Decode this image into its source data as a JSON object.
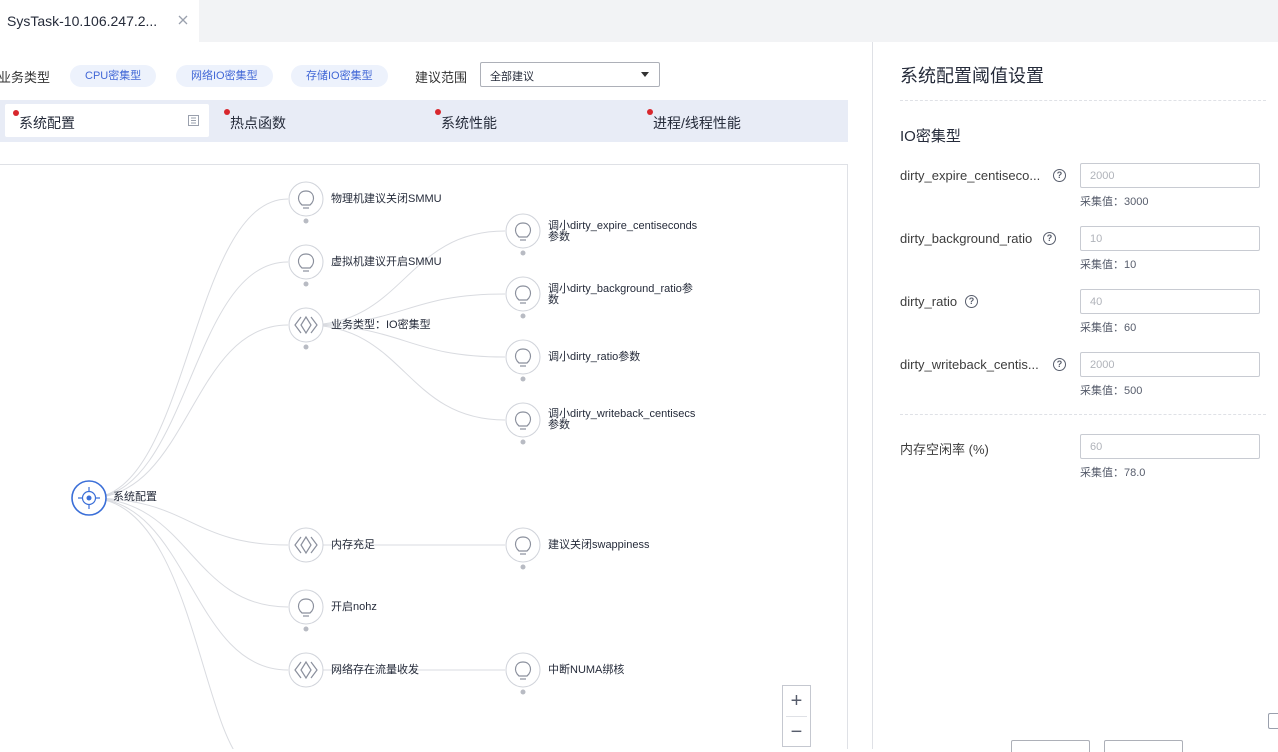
{
  "tab": {
    "title": "SysTask-10.106.247.2...",
    "close_icon": "close-icon"
  },
  "filters": {
    "business_type_label": "业务类型",
    "chips": [
      "CPU密集型",
      "网络IO密集型",
      "存储IO密集型"
    ],
    "scope_label": "建议范围",
    "scope_value": "全部建议"
  },
  "subtabs": [
    {
      "label": "系统配置",
      "active": true
    },
    {
      "label": "热点函数",
      "active": false
    },
    {
      "label": "系统性能",
      "active": false
    },
    {
      "label": "进程/线程性能",
      "active": false
    }
  ],
  "tree": {
    "root": {
      "label": "系统配置",
      "icon": "target-icon"
    },
    "branches": [
      {
        "label": "物理机建议关闭SMMU",
        "icon": "lightbulb-icon"
      },
      {
        "label": "虚拟机建议开启SMMU",
        "icon": "lightbulb-icon"
      },
      {
        "label": "业务类型：IO密集型",
        "icon": "diamond-icon"
      },
      {
        "label": "内存充足",
        "icon": "diamond-icon"
      },
      {
        "label": "开启nohz",
        "icon": "lightbulb-icon"
      },
      {
        "label": "网络存在流量收发",
        "icon": "diamond-icon"
      }
    ],
    "leaves": [
      {
        "line1": "调小dirty_expire_centiseconds",
        "line2": "参数",
        "icon": "lightbulb-icon"
      },
      {
        "line1": "调小dirty_background_ratio参",
        "line2": "数",
        "icon": "lightbulb-icon"
      },
      {
        "line1": "调小dirty_ratio参数",
        "line2": "",
        "icon": "lightbulb-icon"
      },
      {
        "line1": "调小dirty_writeback_centisecs",
        "line2": "参数",
        "icon": "lightbulb-icon"
      },
      {
        "line1": "建议关闭swappiness",
        "line2": "",
        "icon": "lightbulb-icon"
      },
      {
        "line1": "中断NUMA绑核",
        "line2": "",
        "icon": "lightbulb-icon"
      }
    ]
  },
  "zoom": {
    "in": "+",
    "out": "−"
  },
  "panel": {
    "title": "系统配置阈值设置",
    "section": "IO密集型",
    "params": [
      {
        "label": "dirty_expire_centiseco...",
        "placeholder": "2000",
        "collected": "采集值：3000"
      },
      {
        "label": "dirty_background_ratio",
        "placeholder": "10",
        "collected": "采集值：10"
      },
      {
        "label": "dirty_ratio",
        "placeholder": "40",
        "collected": "采集值：60"
      },
      {
        "label": "dirty_writeback_centis...",
        "placeholder": "2000",
        "collected": "采集值：500"
      }
    ],
    "memory": {
      "label": "内存空闲率 (%)",
      "placeholder": "60",
      "collected": "采集值：78.0"
    }
  },
  "colors": {
    "accent": "#4167d6",
    "dot": "#d8272d",
    "tree_line": "#d9dbe0",
    "root": "#3b6fd8"
  }
}
